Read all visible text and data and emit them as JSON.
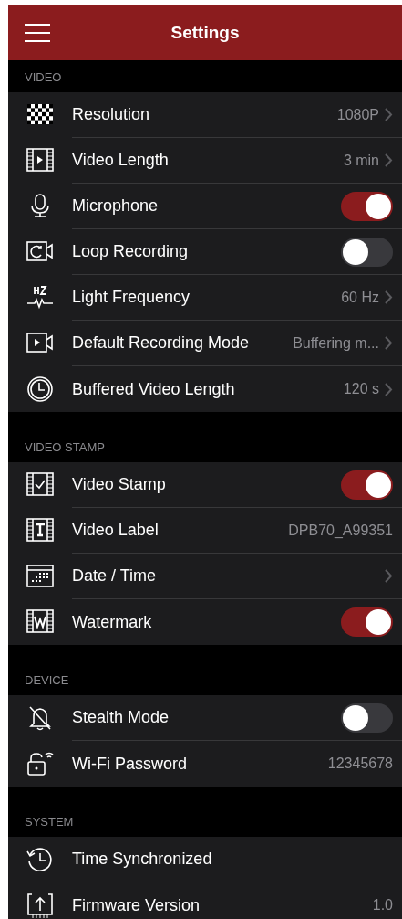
{
  "header": {
    "title": "Settings"
  },
  "sections": [
    {
      "title": "VIDEO",
      "items": [
        {
          "label": "Resolution",
          "kind": "nav",
          "value": "1080P"
        },
        {
          "label": "Video Length",
          "kind": "nav",
          "value": "3 min"
        },
        {
          "label": "Microphone",
          "kind": "toggle",
          "on": true
        },
        {
          "label": "Loop Recording",
          "kind": "toggle",
          "on": false
        },
        {
          "label": "Light Frequency",
          "kind": "nav",
          "value": "60 Hz"
        },
        {
          "label": "Default Recording Mode",
          "kind": "nav",
          "value": "Buffering m..."
        },
        {
          "label": "Buffered Video Length",
          "kind": "nav",
          "value": "120 s"
        }
      ]
    },
    {
      "title": "VIDEO STAMP",
      "items": [
        {
          "label": "Video Stamp",
          "kind": "toggle",
          "on": true
        },
        {
          "label": "Video Label",
          "kind": "info",
          "value": "DPB70_A99351"
        },
        {
          "label": "Date / Time",
          "kind": "nav"
        },
        {
          "label": "Watermark",
          "kind": "toggle",
          "on": true
        }
      ]
    },
    {
      "title": "DEVICE",
      "items": [
        {
          "label": "Stealth Mode",
          "kind": "toggle",
          "on": false
        },
        {
          "label": "Wi-Fi Password",
          "kind": "info",
          "value": "12345678"
        }
      ]
    },
    {
      "title": "SYSTEM",
      "items": [
        {
          "label": "Time Synchronized",
          "kind": "action"
        },
        {
          "label": "Firmware Version",
          "kind": "info",
          "value": "1.0"
        }
      ]
    }
  ]
}
